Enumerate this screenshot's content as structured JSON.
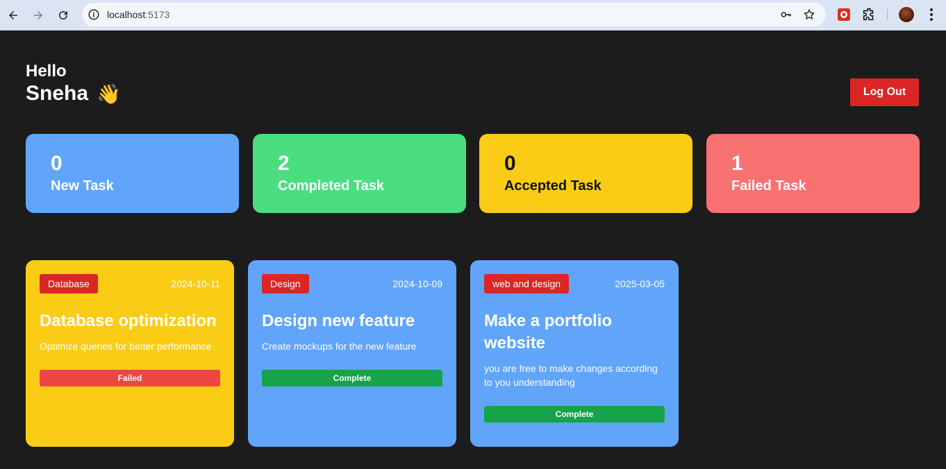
{
  "browser": {
    "url_host": "localhost",
    "url_port": ":5173"
  },
  "header": {
    "greeting": "Hello",
    "name": "Sneha",
    "wave": "👋",
    "logout_label": "Log Out"
  },
  "stats": [
    {
      "count": "0",
      "label": "New Task",
      "color": "#60a5fa"
    },
    {
      "count": "2",
      "label": "Completed Task",
      "color": "#4ade80"
    },
    {
      "count": "0",
      "label": "Accepted Task",
      "color": "#facc15"
    },
    {
      "count": "1",
      "label": "Failed Task",
      "color": "#f87171"
    }
  ],
  "tasks": [
    {
      "category": "Database",
      "date": "2024-10-11",
      "title": "Database optimization",
      "description": "Optimize queries for better performance",
      "status": "Failed",
      "card_color": "#facc15",
      "status_color": "#ef4444"
    },
    {
      "category": "Design",
      "date": "2024-10-09",
      "title": "Design new feature",
      "description": "Create mockups for the new feature",
      "status": "Complete",
      "card_color": "#60a5fa",
      "status_color": "#16a34a"
    },
    {
      "category": "web and design",
      "date": "2025-03-05",
      "title": "Make a portfolio website",
      "description": "you are free to make changes according to you understanding",
      "status": "Complete",
      "card_color": "#60a5fa",
      "status_color": "#16a34a"
    }
  ]
}
